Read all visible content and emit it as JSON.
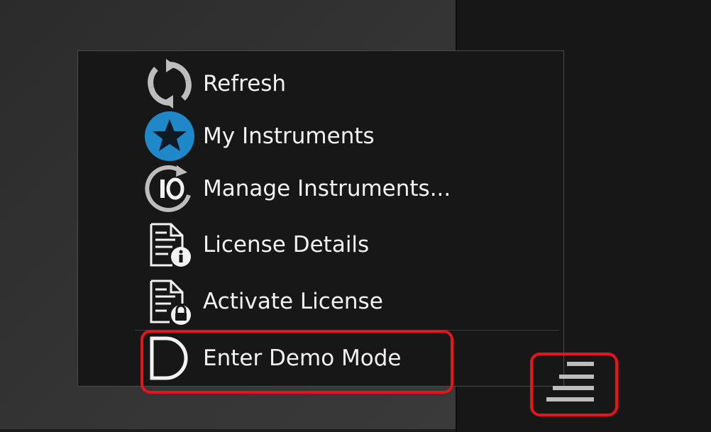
{
  "menu": {
    "items": [
      {
        "label": "Refresh",
        "icon": "refresh-icon"
      },
      {
        "label": "My Instruments",
        "icon": "star-icon"
      },
      {
        "label": "Manage Instruments...",
        "icon": "manage-instruments-icon"
      },
      {
        "label": "License Details",
        "icon": "license-details-icon"
      },
      {
        "label": "Activate License",
        "icon": "activate-license-icon"
      },
      {
        "label": "Enter Demo Mode",
        "icon": "demo-mode-icon"
      }
    ]
  },
  "menu_button": {
    "icon": "hamburger-menu-icon"
  },
  "colors": {
    "highlight": "#e8141c",
    "star_blue": "#1e88c8",
    "text": "#f2f2f2",
    "icon_gray": "#bdbdbd",
    "menu_bg": "#171717"
  }
}
